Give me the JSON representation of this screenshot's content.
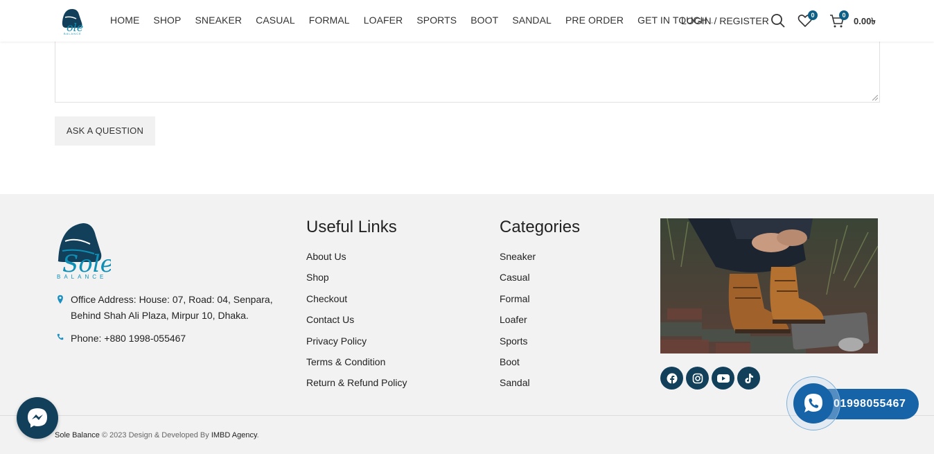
{
  "header": {
    "nav": [
      "HOME",
      "SHOP",
      "SNEAKER",
      "CASUAL",
      "FORMAL",
      "LOAFER",
      "SPORTS",
      "BOOT",
      "SANDAL",
      "PRE ORDER",
      "GET IN TOUCH"
    ],
    "login_label": "LOGIN / REGISTER",
    "wishlist_count": "0",
    "cart_count": "0",
    "cart_total": "0.00৳",
    "icons": [
      "search-icon",
      "heart-icon",
      "cart-icon"
    ]
  },
  "form": {
    "ask_button": "ASK A QUESTION"
  },
  "footer": {
    "address": "Office Address: House: 07, Road: 04, Senpara, Behind Shah Ali Plaza, Mirpur 10, Dhaka.",
    "phone": "Phone: +880 1998-055467",
    "useful_links_title": "Useful Links",
    "useful_links": [
      "About Us",
      "Shop",
      "Checkout",
      "Contact Us",
      "Privacy Policy",
      "Terms & Condition",
      "Return & Refund Policy"
    ],
    "categories_title": "Categories",
    "categories": [
      "Sneaker",
      "Casual",
      "Formal",
      "Loafer",
      "Sports",
      "Boot",
      "Sandal"
    ],
    "social": [
      "facebook-icon",
      "instagram-icon",
      "youtube-icon",
      "tiktok-icon"
    ],
    "copyright_brand": "Sole Balance",
    "copyright_mid": " 2023 Design & Developed By ",
    "copyright_agency": "IMBD Agency",
    "copyright_end": "."
  },
  "whatsapp_number": "01998055467",
  "colors": {
    "brand": "#12405b",
    "accent": "#1663a8",
    "logo_teal": "#0f8fb5"
  }
}
